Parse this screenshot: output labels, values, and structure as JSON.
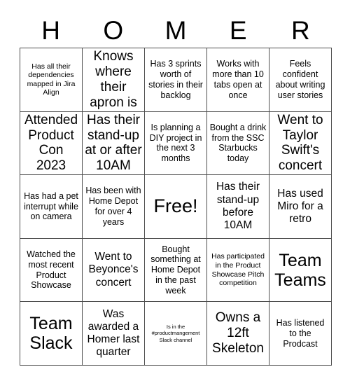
{
  "card": {
    "title": "HOMER",
    "header_letters": [
      "H",
      "O",
      "M",
      "E",
      "R"
    ],
    "grid_size": "5x5",
    "colors": {
      "background": "#ffffff",
      "border": "#4d4d4d",
      "text": "#000000"
    },
    "cells": [
      {
        "row": 1,
        "col": 1,
        "text": "Has all their dependencies mapped in Jira Align",
        "size": "sz-sm"
      },
      {
        "row": 1,
        "col": 2,
        "text": "Knows where their apron is",
        "size": "sz-xl"
      },
      {
        "row": 1,
        "col": 3,
        "text": "Has 3 sprints worth of stories in their backlog",
        "size": "sz-md"
      },
      {
        "row": 1,
        "col": 4,
        "text": "Works with more than 10 tabs open at once",
        "size": "sz-md"
      },
      {
        "row": 1,
        "col": 5,
        "text": "Feels confident about writing user stories",
        "size": "sz-md"
      },
      {
        "row": 2,
        "col": 1,
        "text": "Attended Product Con 2023",
        "size": "sz-xl"
      },
      {
        "row": 2,
        "col": 2,
        "text": "Has their stand-up at or after 10AM",
        "size": "sz-xl"
      },
      {
        "row": 2,
        "col": 3,
        "text": "Is planning a DIY project in the next 3 months",
        "size": "sz-md"
      },
      {
        "row": 2,
        "col": 4,
        "text": "Bought a drink from the SSC Starbucks today",
        "size": "sz-md"
      },
      {
        "row": 2,
        "col": 5,
        "text": "Went to Taylor Swift's concert",
        "size": "sz-xl"
      },
      {
        "row": 3,
        "col": 1,
        "text": "Has had a pet interrupt while on camera",
        "size": "sz-md"
      },
      {
        "row": 3,
        "col": 2,
        "text": "Has been with Home Depot for over 4 years",
        "size": "sz-md"
      },
      {
        "row": 3,
        "col": 3,
        "text": "Free!",
        "size": "sz-free"
      },
      {
        "row": 3,
        "col": 4,
        "text": "Has their stand-up before 10AM",
        "size": "sz-lg"
      },
      {
        "row": 3,
        "col": 5,
        "text": "Has used Miro for a retro",
        "size": "sz-lg"
      },
      {
        "row": 4,
        "col": 1,
        "text": "Watched the most recent Product Showcase",
        "size": "sz-md"
      },
      {
        "row": 4,
        "col": 2,
        "text": "Went to Beyonce's concert",
        "size": "sz-lg"
      },
      {
        "row": 4,
        "col": 3,
        "text": "Bought something at Home Depot in the past week",
        "size": "sz-md"
      },
      {
        "row": 4,
        "col": 4,
        "text": "Has participated in the Product Showcase Pitch competition",
        "size": "sz-sm"
      },
      {
        "row": 4,
        "col": 5,
        "text": "Team Teams",
        "size": "sz-xxl"
      },
      {
        "row": 5,
        "col": 1,
        "text": "Team Slack",
        "size": "sz-xxl"
      },
      {
        "row": 5,
        "col": 2,
        "text": "Was awarded a Homer last quarter",
        "size": "sz-lg"
      },
      {
        "row": 5,
        "col": 3,
        "text": "Is in the #productmangement Slack channel",
        "size": "sz-xs"
      },
      {
        "row": 5,
        "col": 4,
        "text": "Owns a 12ft Skeleton",
        "size": "sz-xl"
      },
      {
        "row": 5,
        "col": 5,
        "text": "Has listened to the Prodcast",
        "size": "sz-md"
      }
    ]
  }
}
